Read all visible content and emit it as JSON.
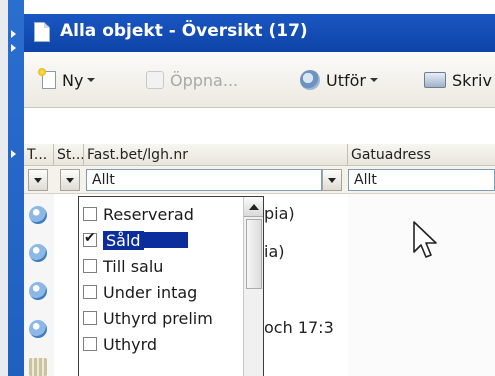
{
  "window": {
    "title": "Alla objekt - Översikt (17)"
  },
  "toolbar": {
    "new_label": "Ny",
    "open_label": "Öppna...",
    "action_label": "Utför",
    "print_label": "Skriv"
  },
  "grid": {
    "headers": [
      "T...",
      "St...",
      "Fast.bet/lgh.nr",
      "Gatuadress"
    ],
    "filter_values": {
      "fast_bet": "Allt",
      "gatuadress": "Allt"
    },
    "rows": [
      {
        "text": "pia)"
      },
      {
        "text": "ia)"
      },
      {
        "text": ""
      },
      {
        "text": "och 17:3"
      },
      {
        "text": ""
      }
    ]
  },
  "status_dropdown": {
    "options": [
      {
        "label": "Reserverad",
        "checked": false
      },
      {
        "label": "Såld",
        "checked": true,
        "selected": true
      },
      {
        "label": "Till salu",
        "checked": false
      },
      {
        "label": "Under intag",
        "checked": false
      },
      {
        "label": "Uthyrd prelim",
        "checked": false
      },
      {
        "label": "Uthyrd",
        "checked": false
      }
    ]
  },
  "icons": {
    "title": "document-icon",
    "new": "new-document-icon",
    "open": "open-icon",
    "action": "gear-icon",
    "print": "printer-icon",
    "row": "globe-icon",
    "row_last": "grid-icon",
    "cursor": "mouse-pointer-icon"
  }
}
